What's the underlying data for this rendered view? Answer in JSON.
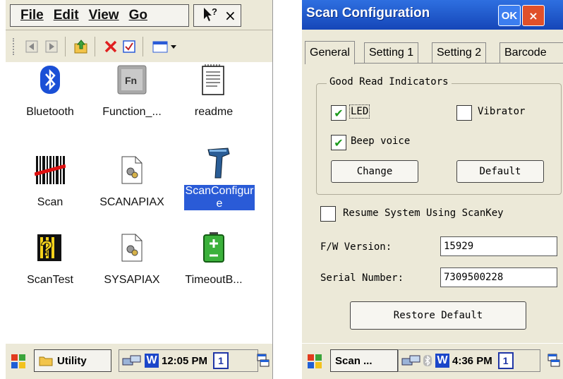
{
  "left": {
    "menu": {
      "file": "File",
      "edit": "Edit",
      "view": "View",
      "go": "Go",
      "help_icon": "help-icon",
      "close_label": "×"
    },
    "toolbar": {
      "icons": [
        "back-arrow-icon",
        "forward-arrow-icon",
        "up-folder-icon",
        "delete-icon",
        "properties-icon",
        "view-menu-icon"
      ]
    },
    "items": [
      {
        "label": "Bluetooth",
        "icon": "bluetooth-icon"
      },
      {
        "label": "Function_...",
        "icon": "fn-key-icon"
      },
      {
        "label": "readme",
        "icon": "document-icon"
      },
      {
        "label": "Scan",
        "icon": "barcode-icon"
      },
      {
        "label": "SCANAPIAX",
        "icon": "gear-file-icon"
      },
      {
        "label": "ScanConfigur e",
        "line1": "ScanConfigur",
        "line2": "e",
        "icon": "scanner-icon",
        "selected": true
      },
      {
        "label": "ScanTest",
        "icon": "help-book-icon"
      },
      {
        "label": "SYSAPIAX",
        "icon": "gear-file-icon"
      },
      {
        "label": "TimeoutB...",
        "icon": "battery-icon"
      }
    ],
    "taskbar": {
      "window_label": "Utility",
      "clock": "12:05 PM",
      "input_indicator": "1"
    }
  },
  "right": {
    "title": "Scan Configuration",
    "ok_label": "OK",
    "close_label": "×",
    "tabs": [
      "General",
      "Setting 1",
      "Setting 2",
      "Barcode"
    ],
    "active_tab": "General",
    "group_title": "Good Read Indicators",
    "led": {
      "label": "LED",
      "checked": true
    },
    "vibrator": {
      "label": "Vibrator",
      "checked": false
    },
    "beep": {
      "label": "Beep voice",
      "checked": true
    },
    "change_label": "Change",
    "default_label": "Default",
    "resume": {
      "label": "Resume System Using ScanKey",
      "checked": false
    },
    "fw_label": "F/W Version:",
    "fw_value": "15929",
    "serial_label": "Serial Number:",
    "serial_value": "7309500228",
    "restore_label": "Restore Default",
    "taskbar": {
      "window_label": "Scan ...",
      "clock": "4:36 PM",
      "input_indicator": "1"
    }
  },
  "colors": {
    "titlebar": "#1546b8",
    "selection": "#2a5bd7",
    "check": "#1c9a1c",
    "ok": "#3c7ef0",
    "close": "#e0502a"
  }
}
